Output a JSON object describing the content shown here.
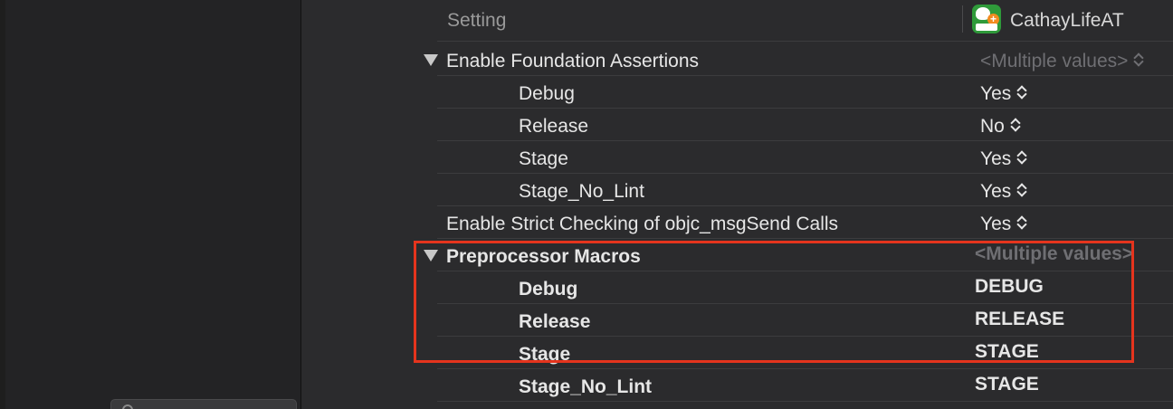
{
  "header": {
    "setting_label": "Setting",
    "target_name": "CathayLifeAT",
    "app_icon": "cathaylife-app-icon"
  },
  "groups": [
    {
      "name": "Enable Foundation Assertions",
      "value": "<Multiple values>",
      "expanded": true,
      "children": [
        {
          "name": "Debug",
          "value": "Yes"
        },
        {
          "name": "Release",
          "value": "No"
        },
        {
          "name": "Stage",
          "value": "Yes"
        },
        {
          "name": "Stage_No_Lint",
          "value": "Yes"
        }
      ]
    },
    {
      "name": "Enable Strict Checking of objc_msgSend Calls",
      "value": "Yes",
      "expanded": false
    },
    {
      "name": "Preprocessor Macros",
      "value": "<Multiple values>",
      "expanded": true,
      "bold": true,
      "children": [
        {
          "name": "Debug",
          "value": "DEBUG"
        },
        {
          "name": "Release",
          "value": "RELEASE"
        },
        {
          "name": "Stage",
          "value": "STAGE"
        },
        {
          "name": "Stage_No_Lint",
          "value": "STAGE"
        }
      ]
    }
  ],
  "colors": {
    "background": "#2b2b2d",
    "text": "#e6e6e6",
    "muted": "#6f6f73",
    "highlight": "#e5341d"
  }
}
